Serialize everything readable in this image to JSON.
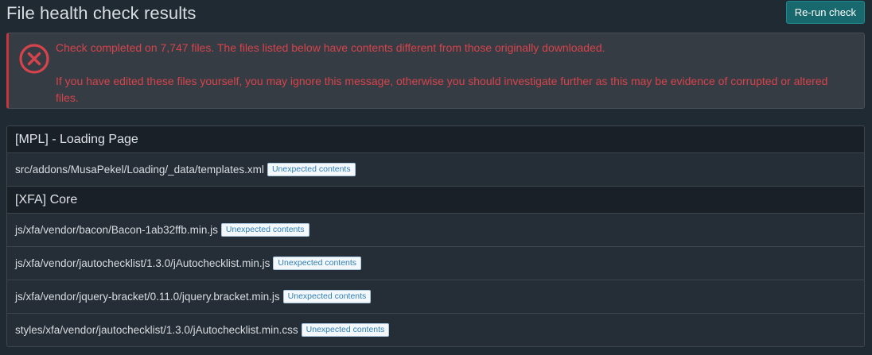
{
  "header": {
    "title": "File health check results",
    "rerun_label": "Re-run check"
  },
  "alert": {
    "icon": "error-circle-x-icon",
    "color": "#d7434b",
    "line1": "Check completed on 7,747 files. The files listed below have contents different from those originally downloaded.",
    "line2": "If you have edited these files yourself, you may ignore this message, otherwise you should investigate further as this may be evidence of corrupted or altered files."
  },
  "groups": [
    {
      "title": "[MPL] - Loading Page",
      "files": [
        {
          "path": "src/addons/MusaPekel/Loading/_data/templates.xml",
          "status": "Unexpected contents"
        }
      ]
    },
    {
      "title": "[XFA] Core",
      "files": [
        {
          "path": "js/xfa/vendor/bacon/Bacon-1ab32ffb.min.js",
          "status": "Unexpected contents"
        },
        {
          "path": "js/xfa/vendor/jautochecklist/1.3.0/jAutochecklist.min.js",
          "status": "Unexpected contents"
        },
        {
          "path": "js/xfa/vendor/jquery-bracket/0.11.0/jquery.bracket.min.js",
          "status": "Unexpected contents"
        },
        {
          "path": "styles/xfa/vendor/jautochecklist/1.3.0/jAutochecklist.min.css",
          "status": "Unexpected contents"
        }
      ]
    }
  ],
  "colors": {
    "background": "#1f2a33",
    "accent_button": "#17696e",
    "error": "#d7434b",
    "badge_text": "#2f7fb6"
  }
}
